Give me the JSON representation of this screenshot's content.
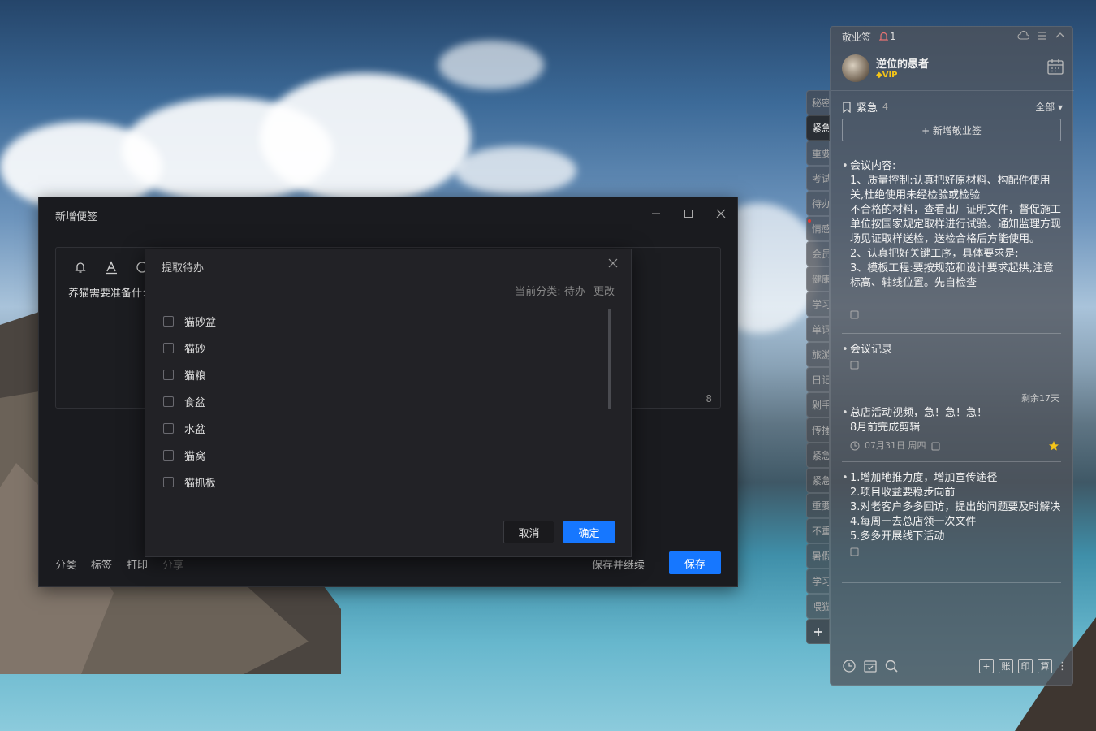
{
  "note_window": {
    "title": "新增便签",
    "editor_text": "养猫需要准备什么",
    "char_count": "8",
    "footer": {
      "category": "分类",
      "tag": "标签",
      "print": "打印",
      "share": "分享",
      "save_continue": "保存并继续",
      "save": "保存"
    }
  },
  "dialog": {
    "title": "提取待办",
    "current_category_label": "当前分类:",
    "current_category_value": "待办",
    "change": "更改",
    "items": [
      "猫砂盆",
      "猫砂",
      "猫粮",
      "食盆",
      "水盆",
      "猫窝",
      "猫抓板"
    ],
    "cancel": "取消",
    "ok": "确定"
  },
  "side_tabs": [
    "秘密",
    "紧急",
    "重要",
    "考试",
    "待办",
    "情感",
    "会员",
    "健康",
    "学习",
    "单词",
    "旅游",
    "日记",
    "剁手",
    "传播",
    "紧急",
    "紧急",
    "重要",
    "不重",
    "暑假",
    "学习",
    "喂猫"
  ],
  "panel": {
    "app_name": "敬业签",
    "reminder_count": "1",
    "username": "逆位的愚者",
    "vip": "VIP",
    "category": "紧急",
    "category_count": "4",
    "filter": "全部",
    "add_note": "+ 新增敬业签",
    "notes": [
      {
        "text": "会议内容:\n1、质量控制:认真把好原材料、构配件使用关,杜绝使用未经检验或检验\n不合格的材料，查看出厂证明文件，督促施工单位按国家规定取样进行试验。通知监理方现场见证取样送检，送检合格后方能使用。\n2、认真把好关键工序，具体要求是:\n3、模板工程:要按规范和设计要求起拱,注意标高、轴线位置。先自检查"
      },
      {
        "text": "会议记录"
      },
      {
        "text": "总店活动视频，急！急！急！\n8月前完成剪辑",
        "remaining": "剩余17天",
        "date": "07月31日 周四"
      },
      {
        "text": "1.增加地推力度，增加宣传途径\n2.项目收益要稳步向前\n3.对老客户多多回访，提出的问题要及时解决\n4.每周一去总店领一次文件\n5.多多开展线下活动"
      }
    ],
    "bottom_buttons": [
      "账",
      "印",
      "算"
    ]
  }
}
